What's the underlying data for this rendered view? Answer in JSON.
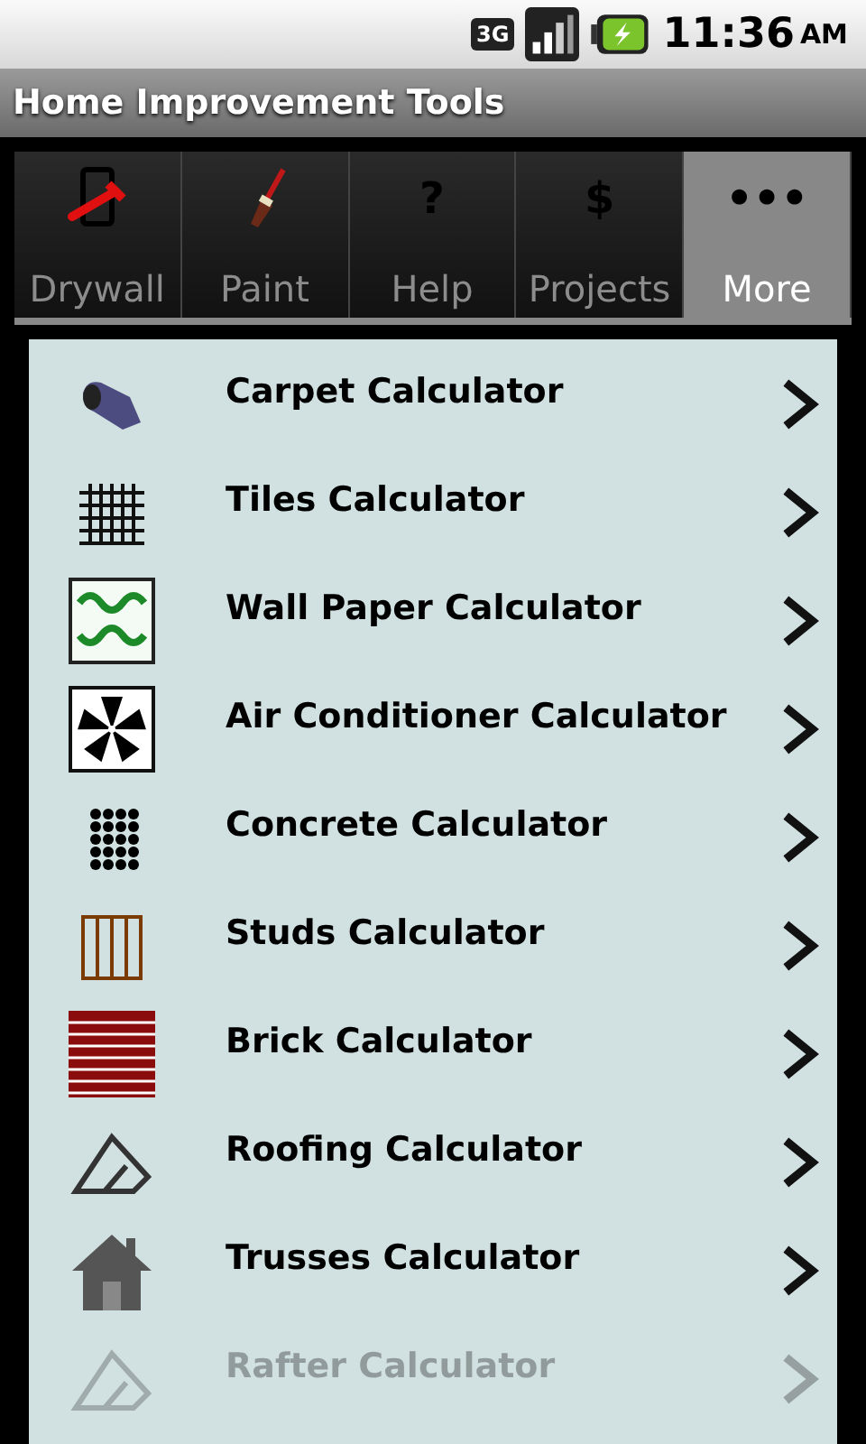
{
  "status_bar": {
    "network": "3G",
    "time": "11:36",
    "ampm": "AM"
  },
  "title": "Home Improvement Tools",
  "tabs": [
    {
      "label": "Drywall",
      "kind": "drywall",
      "selected": false
    },
    {
      "label": "Paint",
      "kind": "paint",
      "selected": false
    },
    {
      "label": "Help",
      "kind": "glyph",
      "symbol": "?",
      "selected": false
    },
    {
      "label": "Projects",
      "kind": "glyph",
      "symbol": "$",
      "selected": false
    },
    {
      "label": "More",
      "kind": "glyph",
      "symbol": "•••",
      "selected": true
    }
  ],
  "items": [
    {
      "label": "Carpet Calculator",
      "kind": "carpet",
      "faded": false
    },
    {
      "label": "Tiles Calculator",
      "kind": "tiles",
      "faded": false
    },
    {
      "label": "Wall Paper Calculator",
      "kind": "wallpaper",
      "faded": false
    },
    {
      "label": "Air Conditioner Calculator",
      "kind": "fan",
      "faded": false
    },
    {
      "label": "Concrete Calculator",
      "kind": "concrete",
      "faded": false
    },
    {
      "label": "Studs Calculator",
      "kind": "studs",
      "faded": false
    },
    {
      "label": "Brick Calculator",
      "kind": "brick",
      "faded": false
    },
    {
      "label": "Roofing Calculator",
      "kind": "roof",
      "faded": false
    },
    {
      "label": "Trusses Calculator",
      "kind": "house",
      "faded": false
    },
    {
      "label": "Rafter Calculator",
      "kind": "roof",
      "faded": true
    }
  ]
}
